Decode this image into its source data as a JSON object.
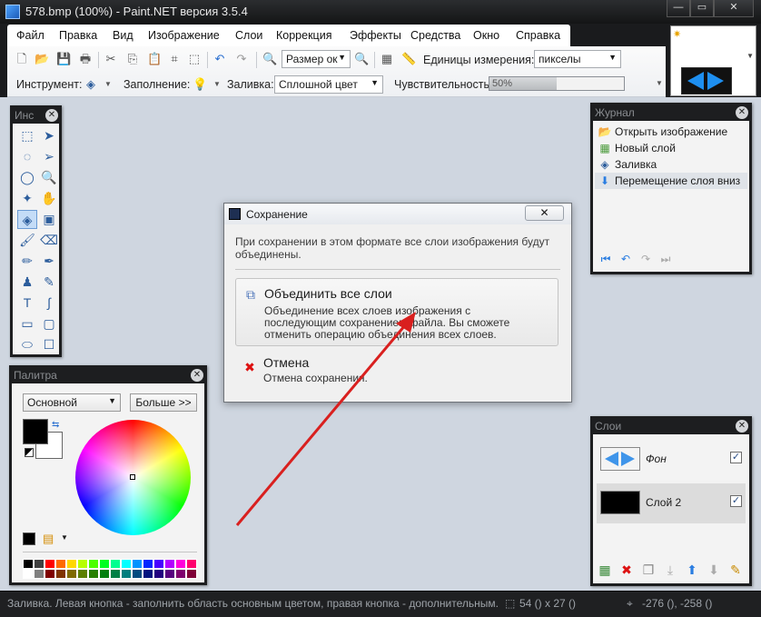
{
  "window": {
    "title": "578.bmp (100%) - Paint.NET версия 3.5.4",
    "minimize": "—",
    "maximize": "▭",
    "close": "✕"
  },
  "menu": [
    "Файл",
    "Правка",
    "Вид",
    "Изображение",
    "Слои",
    "Коррекция",
    "Эффекты",
    "Средства",
    "Окно",
    "Справка"
  ],
  "toolbar": {
    "zoom_value": "Размер ок",
    "units_label": "Единицы измерения:",
    "units_value": "пикселы",
    "tool_label": "Инструмент:",
    "fill_label": "Заполнение:",
    "pour_label": "Заливка:",
    "pour_value": "Сплошной цвет",
    "sensitivity_label": "Чувствительность:",
    "sensitivity_value": "50%",
    "sensitivity_fraction": 0.5
  },
  "tools_panel": {
    "title": "Инс",
    "close": "✕"
  },
  "palette": {
    "title": "Палитра",
    "close": "✕",
    "mode": "Основной",
    "more_button": "Больше >>",
    "primary_color": "#000000",
    "secondary_color": "#ffffff",
    "swatch_colors": [
      "#000000",
      "#404040",
      "#ff0000",
      "#ff6a00",
      "#ffd800",
      "#b6ff00",
      "#4cff00",
      "#00ff21",
      "#00ff90",
      "#00ffff",
      "#0094ff",
      "#0026ff",
      "#4800ff",
      "#b200ff",
      "#ff00dc",
      "#ff006e",
      "#ffffff",
      "#808080",
      "#7f0000",
      "#7f3300",
      "#7f6a00",
      "#5b7f00",
      "#267f00",
      "#007f0e",
      "#007f46",
      "#007f7f",
      "#004a7f",
      "#00137f",
      "#21007f",
      "#57007f",
      "#7f006e",
      "#7f0037"
    ]
  },
  "history": {
    "title": "Журнал",
    "close": "✕",
    "items": [
      {
        "label": "Открыть изображение",
        "icon": "📂"
      },
      {
        "label": "Новый слой",
        "icon": "▦"
      },
      {
        "label": "Заливка",
        "icon": "◈"
      },
      {
        "label": "Перемещение слоя вниз",
        "icon": "⬇"
      }
    ],
    "selected_index": 3
  },
  "layers": {
    "title": "Слои",
    "close": "✕",
    "items": [
      {
        "name": "Фон",
        "visible": "✓"
      },
      {
        "name": "Слой 2",
        "visible": "✓"
      }
    ],
    "selected_index": 1
  },
  "dialog": {
    "title": "Сохранение",
    "close": "✕",
    "message": "При сохранении в этом формате все слои изображения будут объединены.",
    "option_flatten_title": "Объединить все слои",
    "option_flatten_desc": "Объединение всех слоев изображения с последующим сохранением файла. Вы сможете отменить операцию объединения всех слоев.",
    "option_cancel_title": "Отмена",
    "option_cancel_desc": "Отмена сохранения."
  },
  "statusbar": {
    "hint": "Заливка. Левая кнопка - заполнить область основным цветом, правая кнопка - дополнительным.",
    "size": "54 () x 27 ()",
    "cursor": "-276 (), -258 ()"
  },
  "colors": {
    "frame": "#1a1b1d",
    "canvas": "#cfd6e0",
    "annotation_arrow": "#d9201f",
    "accent": "#2a7de1"
  }
}
